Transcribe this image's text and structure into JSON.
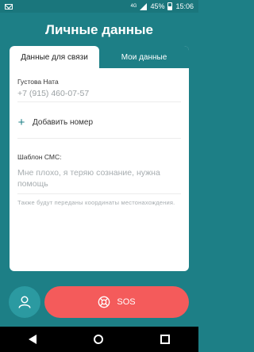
{
  "status_bar": {
    "net_tag": "4G",
    "battery": "45%",
    "time": "15:06"
  },
  "page": {
    "title": "Личные данные"
  },
  "tabs": [
    {
      "label": "Данные для связи",
      "active": true
    },
    {
      "label": "Мои данные",
      "active": false
    }
  ],
  "contact": {
    "name": "Густова Ната",
    "phone": "+7 (915) 460-07-57"
  },
  "add_number": {
    "label": "Добавить номер",
    "icon": "plus-icon"
  },
  "sms": {
    "label": "Шаблон СМС:",
    "text": "Мне плохо, я теряю сознание, нужна помощь",
    "hint": "Также будут переданы координаты местонахождения."
  },
  "actions": {
    "profile_icon": "user-icon",
    "sos_label": "SOS",
    "sos_icon": "lifebuoy-icon"
  },
  "colors": {
    "background": "#1d7f86",
    "accent": "#2b9aa1",
    "sos": "#f45b5b"
  }
}
